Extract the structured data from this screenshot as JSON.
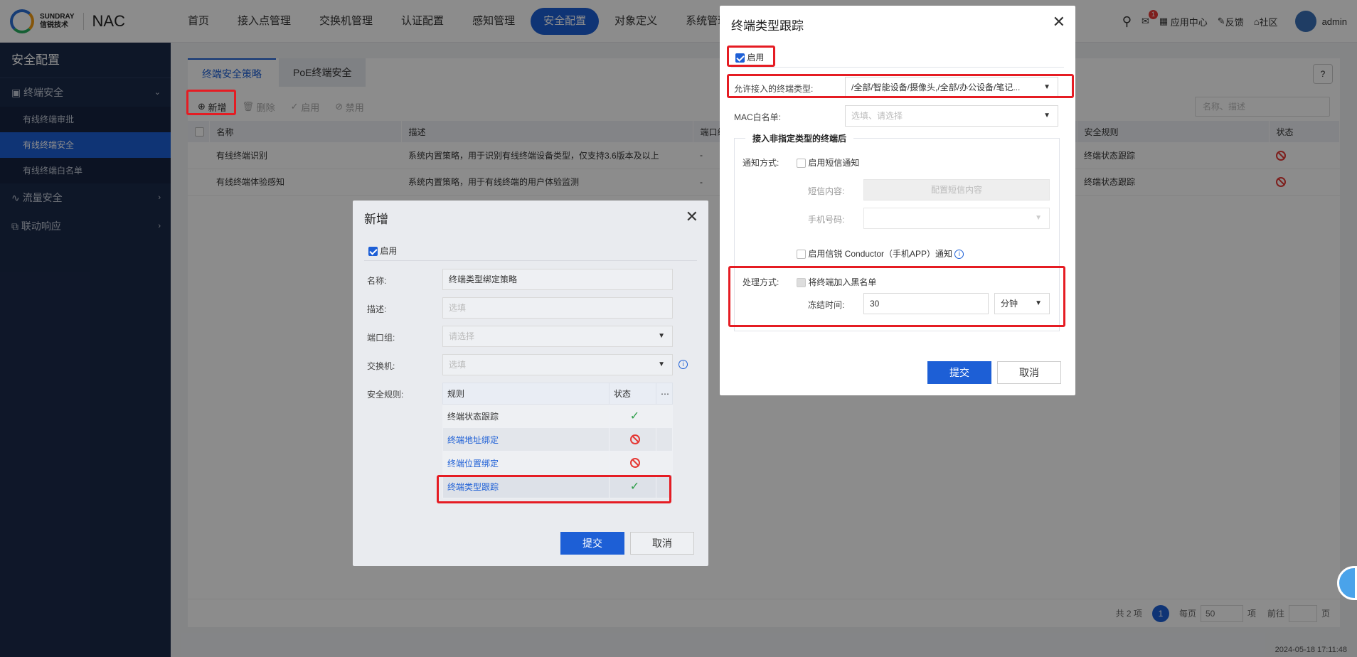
{
  "header": {
    "brand_en": "SUNDRAY",
    "brand_cn": "信锐技术",
    "product": "NAC",
    "nav": [
      "首页",
      "接入点管理",
      "交换机管理",
      "认证配置",
      "感知管理",
      "安全配置",
      "对象定义",
      "系统管理"
    ],
    "active_nav": "安全配置",
    "msg_count": "1",
    "app_center": "应用中心",
    "feedback": "反馈",
    "community": "社区",
    "user": "admin"
  },
  "sidebar": {
    "title": "安全配置",
    "groups": [
      {
        "label": "终端安全",
        "items": [
          "有线终端审批",
          "有线终端安全",
          "有线终端白名单"
        ]
      },
      {
        "label": "流量安全"
      },
      {
        "label": "联动响应"
      }
    ],
    "active_item": "有线终端安全"
  },
  "main": {
    "tabs": [
      "终端安全策略",
      "PoE终端安全"
    ],
    "toolbar": {
      "add": "新增",
      "delete": "删除",
      "enable": "启用",
      "disable": "禁用",
      "search_placeholder": "名称、描述"
    },
    "columns": [
      "名称",
      "描述",
      "端口组",
      "安全规则",
      "状态"
    ],
    "rows": [
      {
        "name": "有线终端识别",
        "desc": "系统内置策略，用于识别有线终端设备类型，仅支持3.6版本及以上",
        "port": "-",
        "rule": "终端状态跟踪"
      },
      {
        "name": "有线终端体验感知",
        "desc": "系统内置策略，用于有线终端的用户体验监测",
        "port": "-",
        "rule": "终端状态跟踪"
      }
    ],
    "pager": {
      "total": "共 2 项",
      "current": "1",
      "per_page_label": "每页",
      "per_page": "50",
      "unit": "项",
      "goto": "前往",
      "page": "页"
    },
    "timestamp": "2024-05-18 17:11:48"
  },
  "dialog_add": {
    "title": "新增",
    "enable_label": "启用",
    "name_label": "名称:",
    "name_value": "终端类型绑定策略",
    "desc_label": "描述:",
    "desc_placeholder": "选填",
    "port_label": "端口组:",
    "port_placeholder": "请选择",
    "switch_label": "交换机:",
    "switch_placeholder": "选填",
    "rules_label": "安全规则:",
    "rules_header": [
      "规则",
      "状态"
    ],
    "rules": [
      {
        "name": "终端状态跟踪",
        "status": "enabled"
      },
      {
        "name": "终端地址绑定",
        "status": "disabled"
      },
      {
        "name": "终端位置绑定",
        "status": "disabled"
      },
      {
        "name": "终端类型跟踪",
        "status": "enabled"
      }
    ],
    "submit": "提交",
    "cancel": "取消"
  },
  "dialog_track": {
    "title": "终端类型跟踪",
    "enable_label": "启用",
    "allowed_label": "允许接入的终端类型:",
    "allowed_value": "/全部/智能设备/摄像头,/全部/办公设备/笔记...",
    "mac_label": "MAC白名单:",
    "mac_placeholder": "选填、请选择",
    "section_title": "接入非指定类型的终端后",
    "notify_label": "通知方式:",
    "sms_label": "启用短信通知",
    "sms_content_label": "短信内容:",
    "sms_content_btn": "配置短信内容",
    "phone_label": "手机号码:",
    "conductor_label": "启用信锐 Conductor（手机APP）通知",
    "handle_label": "处理方式:",
    "blacklist_label": "将终端加入黑名单",
    "freeze_label": "冻结时间:",
    "freeze_value": "30",
    "freeze_unit": "分钟",
    "submit": "提交",
    "cancel": "取消"
  }
}
